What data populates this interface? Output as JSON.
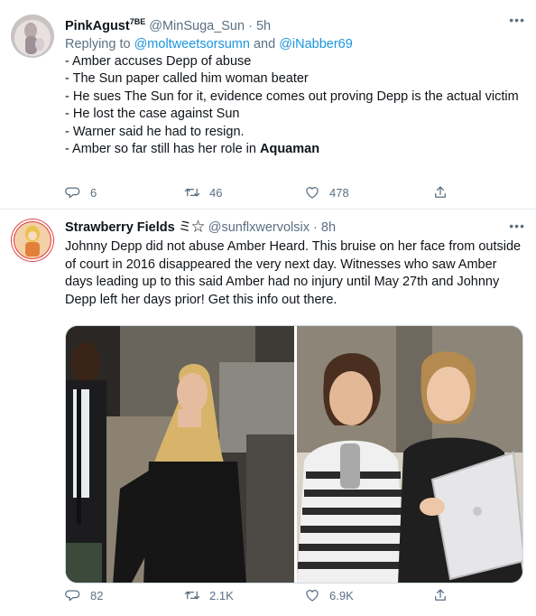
{
  "tweets": [
    {
      "display_name": "PinkAgust",
      "badge": "7BE",
      "handle": "@MinSuga_Sun",
      "dot": "·",
      "time": "5h",
      "more_label": "•••",
      "reply_prefix": "Replying to",
      "reply_mention_1": "@moltweetsorsumn",
      "reply_and": "and",
      "reply_mention_2": "@iNabber69",
      "lines": [
        "- Amber accuses Depp of abuse",
        "- The Sun paper called him woman beater",
        "- He sues The Sun for it, evidence comes out proving Depp is the actual victim",
        "- He lost the case against Sun",
        "- Warner said he had to resign.",
        "- Amber so far still has her role in"
      ],
      "bold_word": "Aquaman",
      "replies": "6",
      "retweets": "46",
      "likes": "478"
    },
    {
      "display_name": "Strawberry Fields",
      "name_glyphs": "ミ☆",
      "handle": "@sunflxwervolsix",
      "dot": "·",
      "time": "8h",
      "more_label": "•••",
      "text": "Johnny Depp did not abuse Amber Heard. This bruise on her face from outside of court in 2016 disappeared the very next day. Witnesses who saw Amber days leading up to this said Amber had no injury until May 27th and Johnny Depp left her days prior! Get this info out there.",
      "replies": "82",
      "retweets": "2.1K",
      "likes": "6.9K"
    }
  ],
  "colors": {
    "text": "#0f1419",
    "secondary": "#5b7083",
    "link": "#1b95e0",
    "border": "#e6ecf0"
  },
  "icons": {
    "reply": "comment-bubble-icon",
    "retweet": "retweet-arrows-icon",
    "like": "heart-outline-icon",
    "share": "share-upload-icon",
    "more": "more-dots-icon"
  }
}
